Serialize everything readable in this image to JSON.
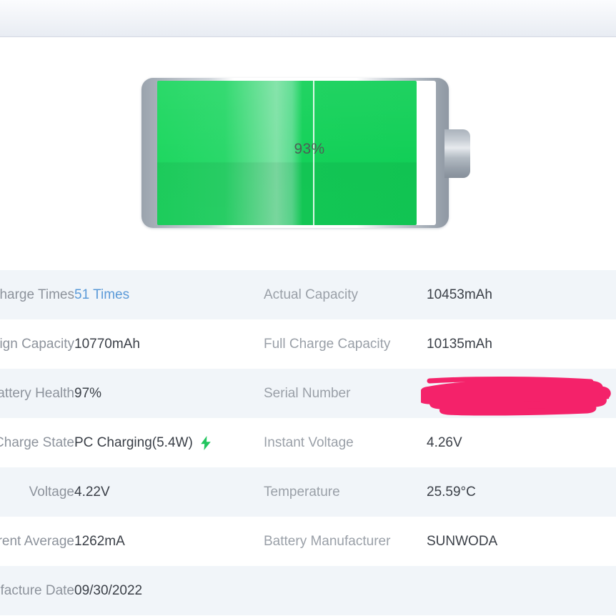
{
  "app": {
    "accent_green": "#1ed760",
    "stripe_color": "#f1f5f9",
    "link_color": "#5b9ad8",
    "redaction_color": "#f4226a"
  },
  "battery": {
    "percent_label": "93%",
    "percent_value": 93,
    "icon_name": "battery-icon"
  },
  "info_rows": [
    {
      "label_left": "Charge Times",
      "label_left_visible": "s",
      "value_left": "51 Times",
      "value_left_style": "link",
      "label_right": "Actual Capacity",
      "value_right": "10453mAh"
    },
    {
      "label_left": "Design Capacity",
      "label_left_visible": "city",
      "value_left": "10770mAh",
      "value_left_style": "plain",
      "label_right": "Full Charge Capacity",
      "value_right": "10135mAh"
    },
    {
      "label_left": "Battery Health",
      "label_left_visible": "",
      "value_left": "97%",
      "value_left_style": "plain",
      "label_right": "Serial Number",
      "value_right": "",
      "value_right_redacted": true
    },
    {
      "label_left": "Charge State",
      "label_left_visible": "e",
      "value_left": "PC Charging(5.4W)",
      "value_left_style": "plain",
      "value_left_icon": "lightning-bolt-icon",
      "label_right": "Instant Voltage",
      "value_right": "4.26V"
    },
    {
      "label_left": "Voltage",
      "label_left_visible": "",
      "value_left": "4.22V",
      "value_left_style": "plain",
      "label_right": "Temperature",
      "value_right": "25.59°C"
    },
    {
      "label_left": "Current Average",
      "label_left_visible": "erage",
      "value_left": "1262mA",
      "value_left_style": "plain",
      "label_right": "Battery Manufacturer",
      "value_right": "SUNWODA"
    },
    {
      "label_left": "Manufacture Date",
      "label_left_visible": "ate",
      "value_left": "09/30/2022",
      "value_left_style": "plain",
      "label_right": "",
      "value_right": ""
    }
  ]
}
